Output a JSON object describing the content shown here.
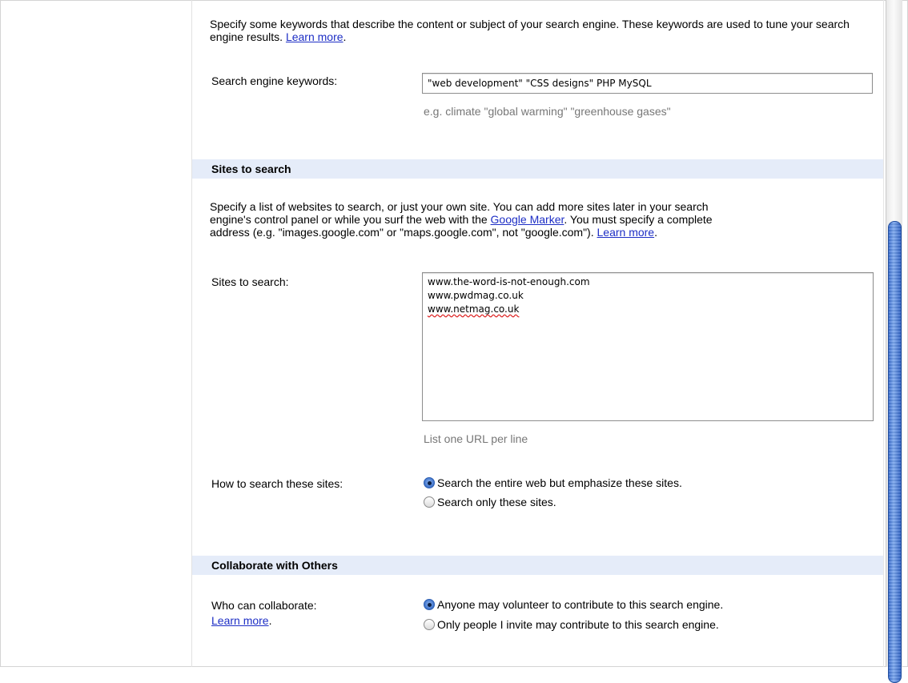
{
  "keywords_section": {
    "intro_text": "Specify some keywords that describe the content or subject of your search engine. These keywords are used to tune your search engine results.",
    "learn_more": "Learn more",
    "field_label": "Search engine keywords:",
    "field_value": "\"web development\" \"CSS designs\" PHP MySQL",
    "hint": "e.g. climate \"global warming\" \"greenhouse gases\""
  },
  "sites_section": {
    "header": "Sites to search",
    "intro_line1": "Specify a list of websites to search, or just your own site. You can add more sites later in your search",
    "intro_line2_prefix": "engine's control panel or while you surf the web with the",
    "google_marker_link": "Google Marker",
    "intro_line2_suffix": ". You must specify a complete",
    "intro_line3": "address (e.g. \"images.google.com\" or \"maps.google.com\", not \"google.com\").",
    "learn_more": "Learn more",
    "field_label": "Sites to search:",
    "sites": [
      "www.the-word-is-not-enough.com",
      "www.pwdmag.co.uk",
      "www.netmag.co.uk"
    ],
    "hint": "List one URL per line",
    "how_label": "How to search these sites:",
    "options": [
      {
        "label": "Search the entire web but emphasize these sites.",
        "selected": true
      },
      {
        "label": "Search only these sites.",
        "selected": false
      }
    ]
  },
  "collaborate_section": {
    "header": "Collaborate with Others",
    "field_label": "Who can collaborate:",
    "learn_more": "Learn more",
    "options": [
      {
        "label": "Anyone may volunteer to contribute to this search engine.",
        "selected": true
      },
      {
        "label": "Only people I invite may contribute to this search engine.",
        "selected": false
      }
    ]
  }
}
